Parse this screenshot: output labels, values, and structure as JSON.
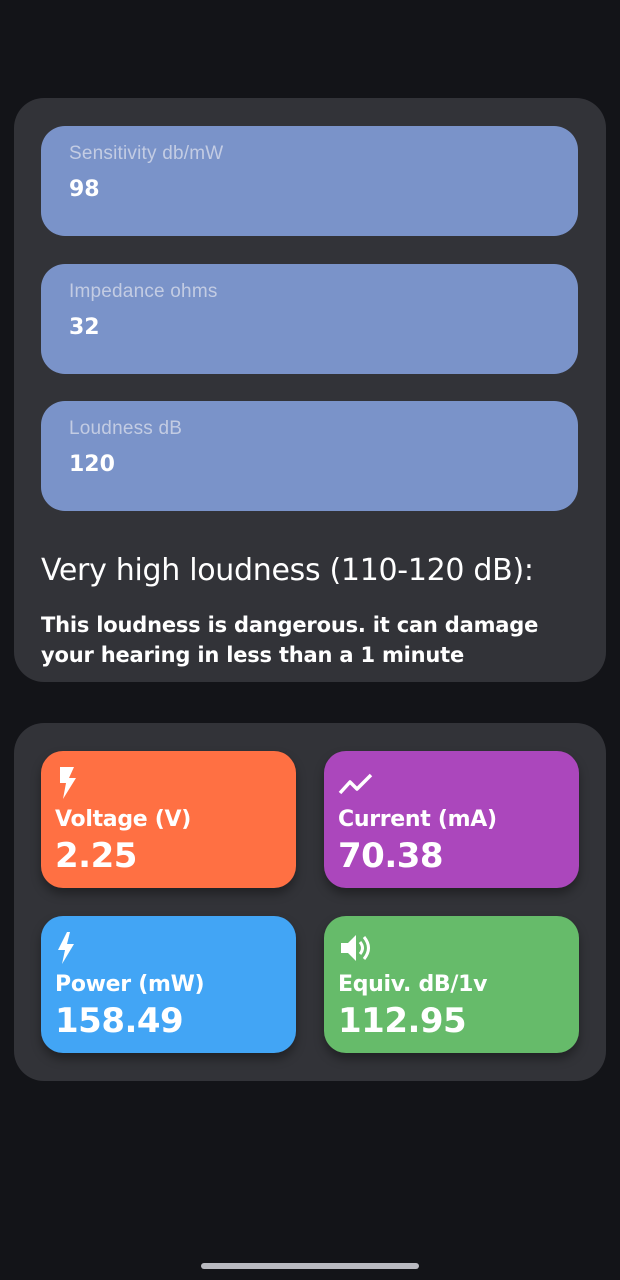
{
  "inputs": {
    "sensitivity": {
      "label": "Sensitivity db/mW",
      "value": "98"
    },
    "impedance": {
      "label": "Impedance ohms",
      "value": "32"
    },
    "loudness": {
      "label": "Loudness dB",
      "value": "120"
    }
  },
  "warning": {
    "title": "Very high loudness (110-120 dB):",
    "text": "This loudness is dangerous. it can damage your hearing in less than a 1 minute"
  },
  "results": {
    "voltage": {
      "label": "Voltage (V)",
      "value": "2.25",
      "icon": "bolt-icon",
      "color": "#ff7043"
    },
    "current": {
      "label": "Current (mA)",
      "value": "70.38",
      "icon": "trending-up-icon",
      "color": "#ab47bc"
    },
    "power": {
      "label": "Power (mW)",
      "value": "158.49",
      "icon": "flash-icon",
      "color": "#42a5f5"
    },
    "equiv": {
      "label": "Equiv. dB/1v",
      "value": "112.95",
      "icon": "volume-icon",
      "color": "#66bb6a"
    }
  }
}
